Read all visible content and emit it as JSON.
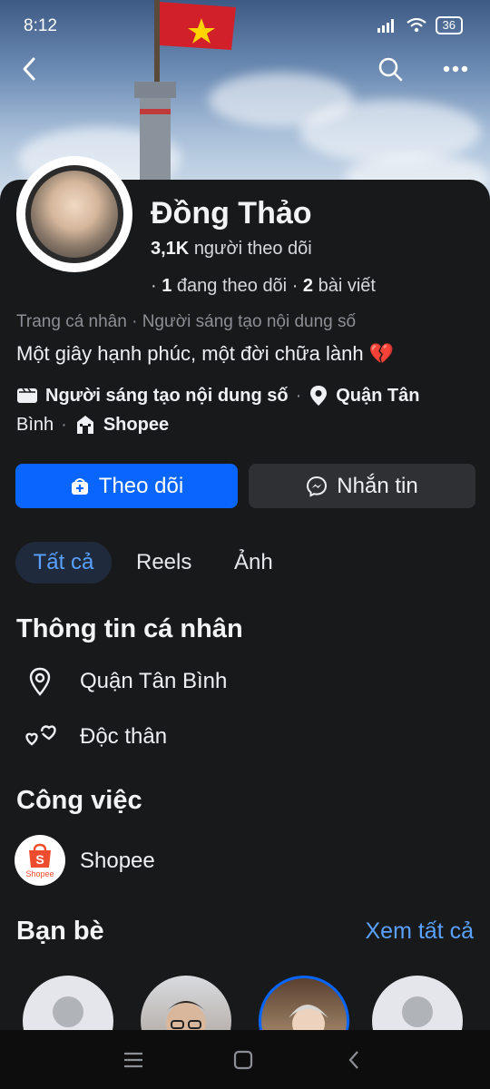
{
  "status": {
    "time": "8:12",
    "battery": "36"
  },
  "profile": {
    "name": "Đồng Thảo",
    "followers_count": "3,1K",
    "followers_label": "người theo dõi",
    "following_count": "1",
    "following_label": "đang theo dõi",
    "posts_count": "2",
    "posts_label": "bài viết",
    "category": "Trang cá nhân · Người sáng tạo nội dung số",
    "bio": "Một giây hạnh phúc, một đời chữa lành 💔",
    "details": {
      "creator": "Người sáng tạo nội dung số",
      "location_1": "Quận Tân",
      "location_2": "Bình",
      "work": "Shopee"
    }
  },
  "actions": {
    "follow": "Theo dõi",
    "message": "Nhắn tin"
  },
  "tabs": [
    {
      "label": "Tất cả"
    },
    {
      "label": "Reels"
    },
    {
      "label": "Ảnh"
    }
  ],
  "personal_info": {
    "title": "Thông tin cá nhân",
    "location": "Quận Tân Bình",
    "relationship": "Độc thân"
  },
  "work": {
    "title": "Công việc",
    "company": "Shopee",
    "logo_text": "Shopee"
  },
  "friends": {
    "title": "Bạn bè",
    "see_all": "Xem tất cả"
  },
  "colors": {
    "accent": "#0866ff",
    "link": "#5aa1ff",
    "background": "#18191b",
    "shopee": "#ee4d2d"
  },
  "icons": [
    "back-icon",
    "search-icon",
    "more-icon",
    "gear-icon",
    "location-icon",
    "heart-icon",
    "messenger-icon",
    "video-icon",
    "store-icon"
  ]
}
